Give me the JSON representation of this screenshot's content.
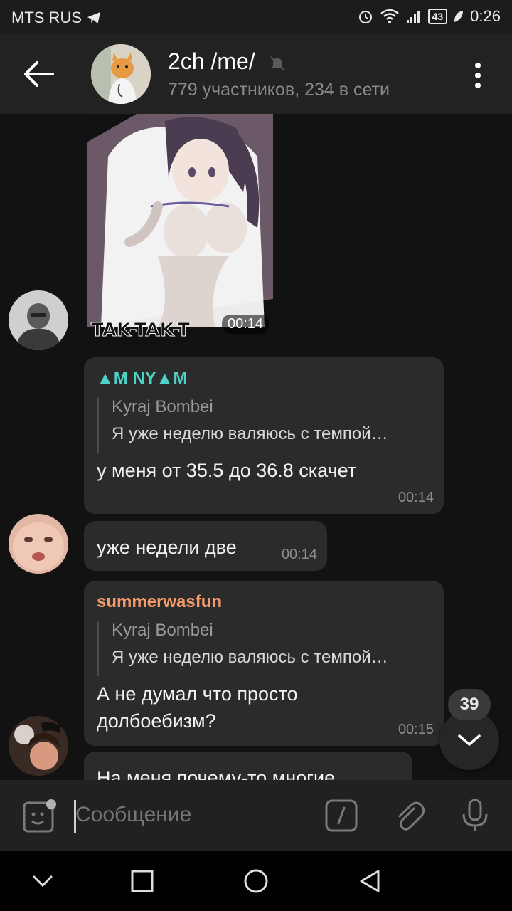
{
  "status_bar": {
    "carrier": "MTS RUS",
    "battery": "43",
    "time": "0:26"
  },
  "header": {
    "title": "2ch /me/",
    "subtitle": "779 участников, 234 в сети"
  },
  "messages": [
    {
      "type": "media",
      "caption_art": "TAK-TAK-T",
      "time": "00:14"
    },
    {
      "type": "reply",
      "sender": "▲M NY▲M",
      "sender_color": "#4fd1c5",
      "quote_name": "Kyraj Bombei",
      "quote_text": "Я уже неделю валяюсь с темпой…",
      "text": "у меня от 35.5 до 36.8 скачет",
      "time": "00:14"
    },
    {
      "type": "text",
      "text": "уже недели две",
      "time": "00:14"
    },
    {
      "type": "reply",
      "sender": "summerwasfun",
      "sender_color": "#f49b6b",
      "quote_name": "Kyraj Bombei",
      "quote_text": "Я уже неделю валяюсь с темпой…",
      "text_line1": "А не думал что просто",
      "text_line2": "долбоебизм?",
      "time": "00:15"
    },
    {
      "type": "text",
      "text": "На меня почему-то многие"
    }
  ],
  "scroll": {
    "unread_count": "39"
  },
  "composer": {
    "placeholder": "Сообщение"
  },
  "icons": {
    "back": "arrow-left-icon",
    "menu": "more-vertical-icon",
    "mute": "muted-bell-icon",
    "sticker": "sticker-icon",
    "command": "slash-command-icon",
    "attach": "paperclip-icon",
    "mic": "microphone-icon"
  }
}
